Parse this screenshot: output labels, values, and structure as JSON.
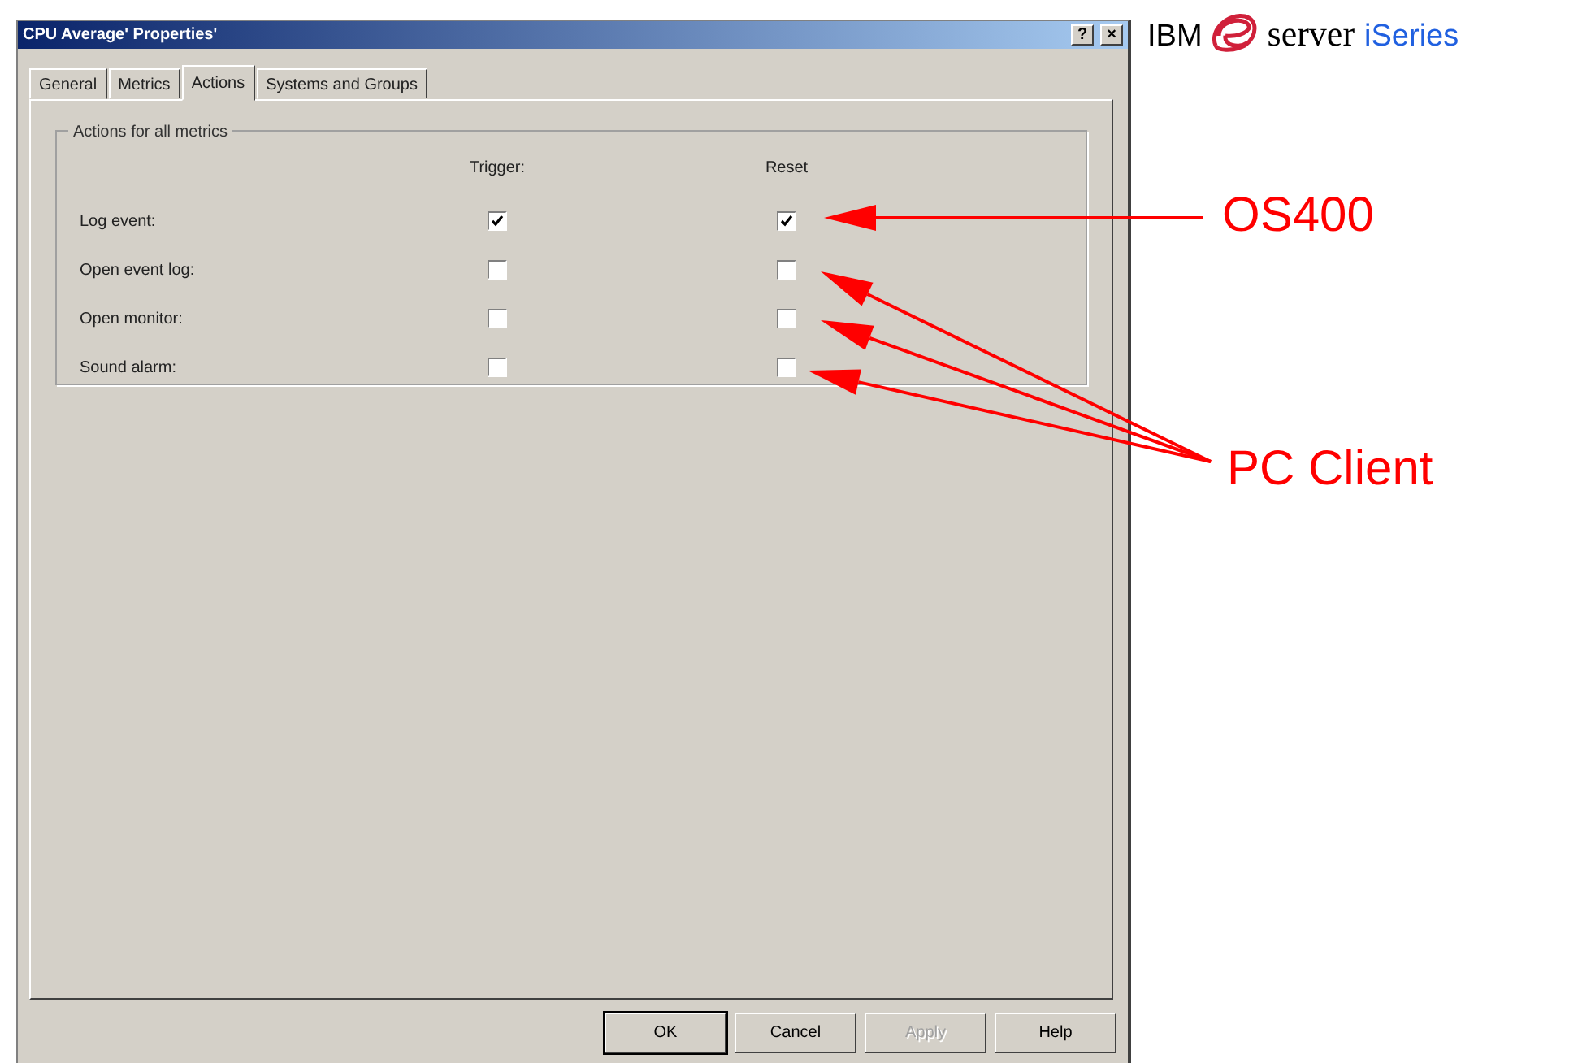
{
  "window": {
    "title": "CPU Average' Properties'",
    "help_button": "?",
    "close_button": "×"
  },
  "tabs": [
    {
      "label": "General",
      "selected": false
    },
    {
      "label": "Metrics",
      "selected": false
    },
    {
      "label": "Actions",
      "selected": true
    },
    {
      "label": "Systems and Groups",
      "selected": false
    }
  ],
  "group": {
    "title": "Actions for all metrics",
    "columns": [
      "Trigger:",
      "Reset"
    ],
    "rows": [
      {
        "label": "Log event:",
        "trigger": true,
        "reset": true
      },
      {
        "label": "Open event log:",
        "trigger": false,
        "reset": false
      },
      {
        "label": "Open monitor:",
        "trigger": false,
        "reset": false
      },
      {
        "label": "Sound alarm:",
        "trigger": false,
        "reset": false
      }
    ]
  },
  "buttons": [
    {
      "label": "OK",
      "disabled": false,
      "default": true
    },
    {
      "label": "Cancel",
      "disabled": false,
      "default": false
    },
    {
      "label": "Apply",
      "disabled": true,
      "default": false
    },
    {
      "label": "Help",
      "disabled": false,
      "default": false
    }
  ],
  "logo": {
    "text_1": "IBM",
    "text_2": "server",
    "text_3": "iSeries"
  },
  "annotations": [
    {
      "label": "OS400"
    },
    {
      "label": "PC Client"
    }
  ]
}
